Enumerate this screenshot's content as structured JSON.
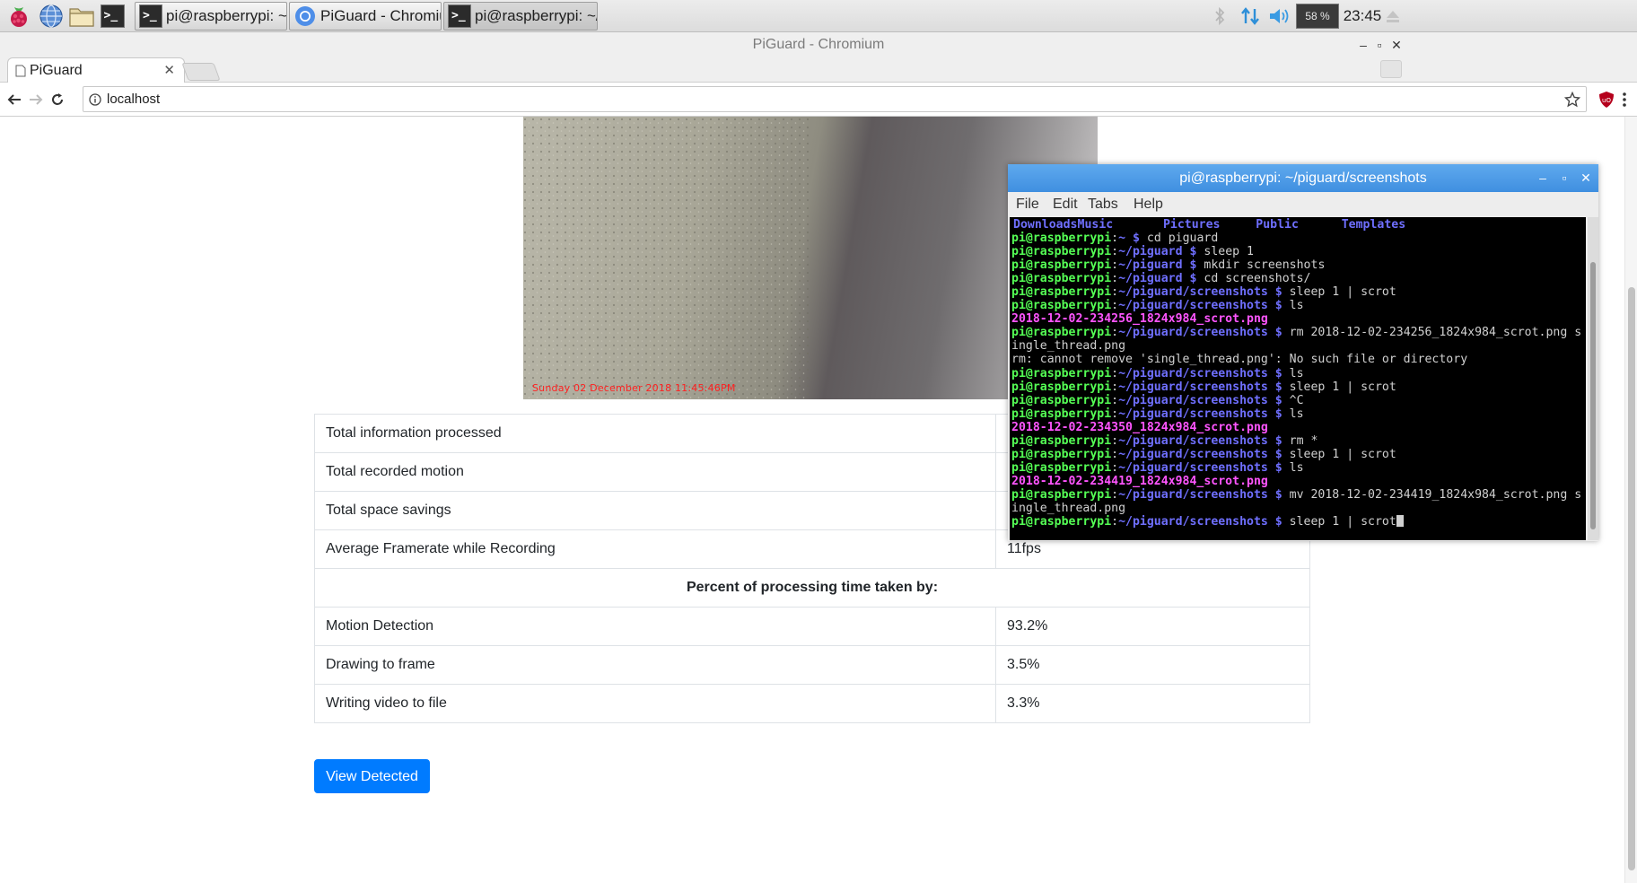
{
  "taskbar": {
    "launchers": [
      {
        "icon": "raspberry-menu-icon"
      },
      {
        "icon": "web-browser-icon"
      },
      {
        "icon": "file-manager-icon"
      },
      {
        "icon": "terminal-icon"
      }
    ],
    "tasks": [
      {
        "label": "pi@raspberrypi: ~/pig...",
        "icon": "terminal-icon",
        "active": false
      },
      {
        "label": "PiGuard - Chromium",
        "icon": "chromium-icon",
        "active": false
      },
      {
        "label": "pi@raspberrypi: ~/pig...",
        "icon": "terminal-icon",
        "active": true
      }
    ],
    "tray": {
      "bluetooth_icon": "bluetooth-icon",
      "network_icon": "network-arrows-icon",
      "volume_icon": "volume-icon",
      "cpu_percent": "58 %",
      "clock": "23:45",
      "eject_icon": "eject-icon"
    }
  },
  "browser": {
    "window_title": "PiGuard - Chromium",
    "tab_title": "PiGuard",
    "url": "localhost",
    "accent_colors": {
      "ublock": "#b5001c",
      "button": "#007bff"
    }
  },
  "page": {
    "camera_timestamp": "Sunday 02 December 2018 11:45:46PM",
    "stats_rows": [
      {
        "label": "Total information processed",
        "value": ""
      },
      {
        "label": "Total recorded motion",
        "value": ""
      },
      {
        "label": "Total space savings",
        "value": ""
      },
      {
        "label": "Average Framerate while Recording",
        "value": "11fps"
      }
    ],
    "processing_heading": "Percent of processing time taken by:",
    "processing_rows": [
      {
        "label": "Motion Detection",
        "value": "93.2%"
      },
      {
        "label": "Drawing to frame",
        "value": "3.5%"
      },
      {
        "label": "Writing video to file",
        "value": "3.3%"
      }
    ],
    "view_detected_label": "View Detected"
  },
  "terminal": {
    "title": "pi@raspberrypi: ~/piguard/screenshots",
    "menu": [
      "File",
      "Edit",
      "Tabs",
      "Help"
    ],
    "lines": [
      {
        "type": "dirs",
        "items": [
          "Downloads",
          "Music",
          "Pictures",
          "Public",
          "Templates"
        ]
      },
      {
        "type": "prompt",
        "user": "pi@raspberrypi",
        "path": "~",
        "cmd": "cd piguard"
      },
      {
        "type": "prompt",
        "user": "pi@raspberrypi",
        "path": "~/piguard",
        "cmd": "sleep 1"
      },
      {
        "type": "prompt",
        "user": "pi@raspberrypi",
        "path": "~/piguard",
        "cmd": "mkdir screenshots"
      },
      {
        "type": "prompt",
        "user": "pi@raspberrypi",
        "path": "~/piguard",
        "cmd": "cd screenshots/"
      },
      {
        "type": "prompt",
        "user": "pi@raspberrypi",
        "path": "~/piguard/screenshots",
        "cmd": "sleep 1 | scrot"
      },
      {
        "type": "prompt",
        "user": "pi@raspberrypi",
        "path": "~/piguard/screenshots",
        "cmd": "ls"
      },
      {
        "type": "file",
        "text": "2018-12-02-234256_1824x984_scrot.png"
      },
      {
        "type": "prompt",
        "user": "pi@raspberrypi",
        "path": "~/piguard/screenshots",
        "cmd": "rm 2018-12-02-234256_1824x984_scrot.png s"
      },
      {
        "type": "out",
        "text": "ingle_thread.png"
      },
      {
        "type": "out",
        "text": "rm: cannot remove 'single_thread.png': No such file or directory"
      },
      {
        "type": "prompt",
        "user": "pi@raspberrypi",
        "path": "~/piguard/screenshots",
        "cmd": "ls"
      },
      {
        "type": "prompt",
        "user": "pi@raspberrypi",
        "path": "~/piguard/screenshots",
        "cmd": "sleep 1 | scrot"
      },
      {
        "type": "prompt",
        "user": "pi@raspberrypi",
        "path": "~/piguard/screenshots",
        "cmd": "^C"
      },
      {
        "type": "prompt",
        "user": "pi@raspberrypi",
        "path": "~/piguard/screenshots",
        "cmd": "ls"
      },
      {
        "type": "file",
        "text": "2018-12-02-234350_1824x984_scrot.png"
      },
      {
        "type": "prompt",
        "user": "pi@raspberrypi",
        "path": "~/piguard/screenshots",
        "cmd": "rm *"
      },
      {
        "type": "prompt",
        "user": "pi@raspberrypi",
        "path": "~/piguard/screenshots",
        "cmd": "sleep 1 | scrot"
      },
      {
        "type": "prompt",
        "user": "pi@raspberrypi",
        "path": "~/piguard/screenshots",
        "cmd": "ls"
      },
      {
        "type": "file",
        "text": "2018-12-02-234419_1824x984_scrot.png"
      },
      {
        "type": "prompt",
        "user": "pi@raspberrypi",
        "path": "~/piguard/screenshots",
        "cmd": "mv 2018-12-02-234419_1824x984_scrot.png s"
      },
      {
        "type": "out",
        "text": "ingle_thread.png"
      },
      {
        "type": "prompt",
        "user": "pi@raspberrypi",
        "path": "~/piguard/screenshots",
        "cmd": "sleep 1 | scrot",
        "cursor": true
      }
    ]
  }
}
